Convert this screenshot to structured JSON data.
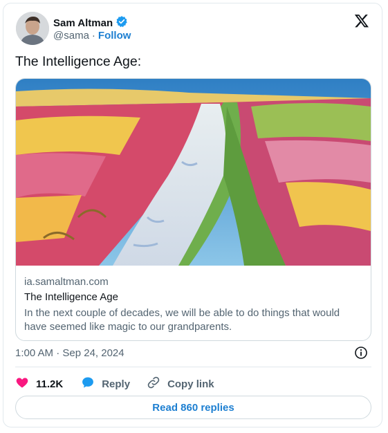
{
  "author": {
    "name": "Sam Altman",
    "verified": true,
    "handle": "@sama",
    "separator": "·",
    "follow_label": "Follow"
  },
  "platform_icon": "x-logo-icon",
  "tweet": {
    "text": "The Intelligence Age:"
  },
  "link_card": {
    "image_icon": "painted-landscape-image",
    "domain": "ia.samaltman.com",
    "title": "The Intelligence Age",
    "description": "In the next couple of decades, we will be able to do things that would have seemed like magic to our grandparents."
  },
  "timestamp": "1:00 AM · Sep 24, 2024",
  "actions": {
    "likes": {
      "icon": "heart-icon",
      "count": "11.2K"
    },
    "reply": {
      "icon": "reply-bubble-icon",
      "label": "Reply"
    },
    "copy_link": {
      "icon": "link-icon",
      "label": "Copy link"
    }
  },
  "read_replies_label": "Read 860 replies",
  "colors": {
    "accent": "#1d7fd1",
    "verified": "#1d9bf0",
    "like": "#f91880",
    "secondary_text": "#536471"
  }
}
